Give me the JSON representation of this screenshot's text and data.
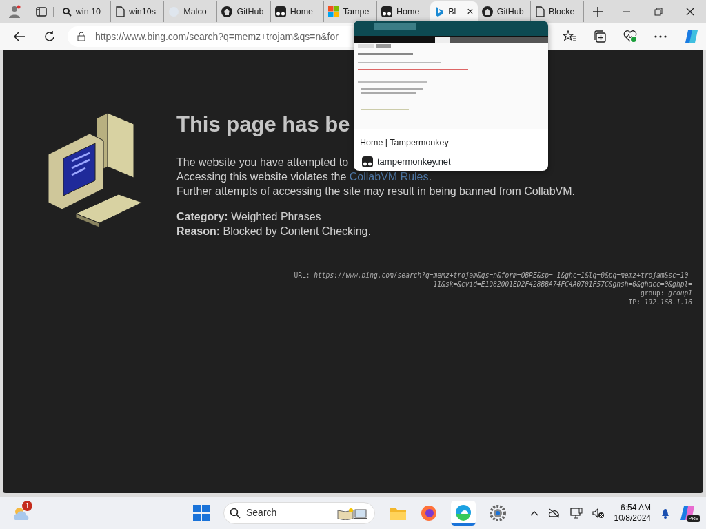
{
  "tabs": [
    {
      "kind": "search",
      "title": "win 10",
      "selected": false
    },
    {
      "kind": "doc",
      "title": "win10s",
      "selected": false
    },
    {
      "kind": "blank",
      "title": "Malco",
      "selected": false
    },
    {
      "kind": "github",
      "title": "GitHub",
      "selected": false
    },
    {
      "kind": "tm",
      "title": "Home",
      "selected": false
    },
    {
      "kind": "ms",
      "title": "Tampe",
      "selected": false
    },
    {
      "kind": "tm",
      "title": "Home",
      "selected": false
    },
    {
      "kind": "bing",
      "title": "Bl",
      "selected": true,
      "close": "×"
    },
    {
      "kind": "github",
      "title": "GitHub",
      "selected": false
    },
    {
      "kind": "doc",
      "title": "Blocke",
      "selected": false
    }
  ],
  "address_bar": {
    "url": "https://www.bing.com/search?q=memz+trojam&qs=n&for"
  },
  "tab_preview": {
    "title": "Home | Tampermonkey",
    "site": "tampermonkey.net"
  },
  "page": {
    "heading": "This page has be",
    "lines": [
      {
        "text": "The website you have attempted to"
      },
      {
        "text": "Accessing this website violates the ",
        "link": "CollabVM Rules",
        "after": "."
      },
      {
        "text": "Further attempts of accessing the site may result in being banned from CollabVM."
      }
    ],
    "details": [
      {
        "label": "Category:",
        "value": "Weighted Phrases"
      },
      {
        "label": "Reason:",
        "value": "Blocked by Content Checking."
      }
    ],
    "info": [
      {
        "label": "URL:",
        "value": "https://www.bing.com/search?q=memz+trojam&qs=n&form=QBRE&sp=-1&ghc=1&lq=0&pq=memz+trojam&sc=10-"
      },
      {
        "value": "11&sk=&cvid=E1982001ED2F428BBA74FC4A0701F57C&ghsh=0&ghacc=0&ghpl="
      },
      {
        "label": "group:",
        "value": "group1"
      },
      {
        "label": "IP:",
        "value": "192.168.1.16"
      }
    ]
  },
  "taskbar": {
    "weather_badge": "1",
    "search_placeholder": "Search",
    "time": "6:54 AM",
    "date": "10/8/2024",
    "copilot_badge": "PRE"
  }
}
